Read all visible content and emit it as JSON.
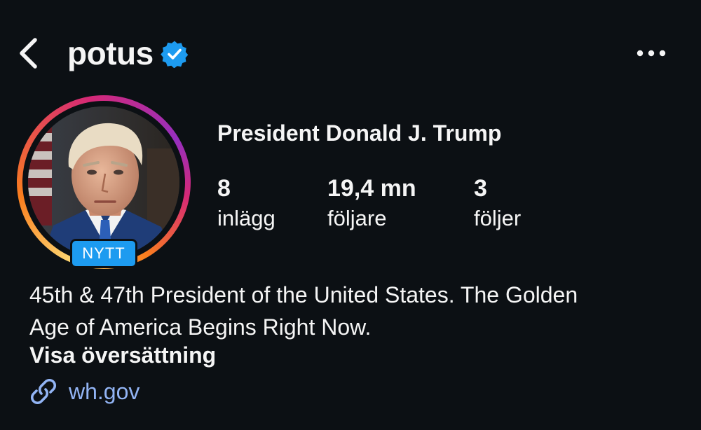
{
  "header": {
    "handle": "potus",
    "verified": true,
    "back_icon": "chevron-left-icon",
    "more_icon": "more-horizontal-icon"
  },
  "profile": {
    "avatar_badge": "NYTT",
    "display_name": "President Donald J. Trump",
    "stats": [
      {
        "value": "8",
        "label": "inlägg"
      },
      {
        "value": "19,4 mn",
        "label": "följare"
      },
      {
        "value": "3",
        "label": "följer"
      }
    ],
    "bio_line1": "45th & 47th President of the United States. The Golden",
    "bio_line2": "Age of America Begins Right Now.",
    "translate_label": "Visa översättning",
    "link": "wh.gov"
  },
  "colors": {
    "background": "#0c1014",
    "text": "#f5f5f5",
    "verified": "#1d9bf0",
    "link": "#92b4f4",
    "badge": "#1d9bf0"
  }
}
